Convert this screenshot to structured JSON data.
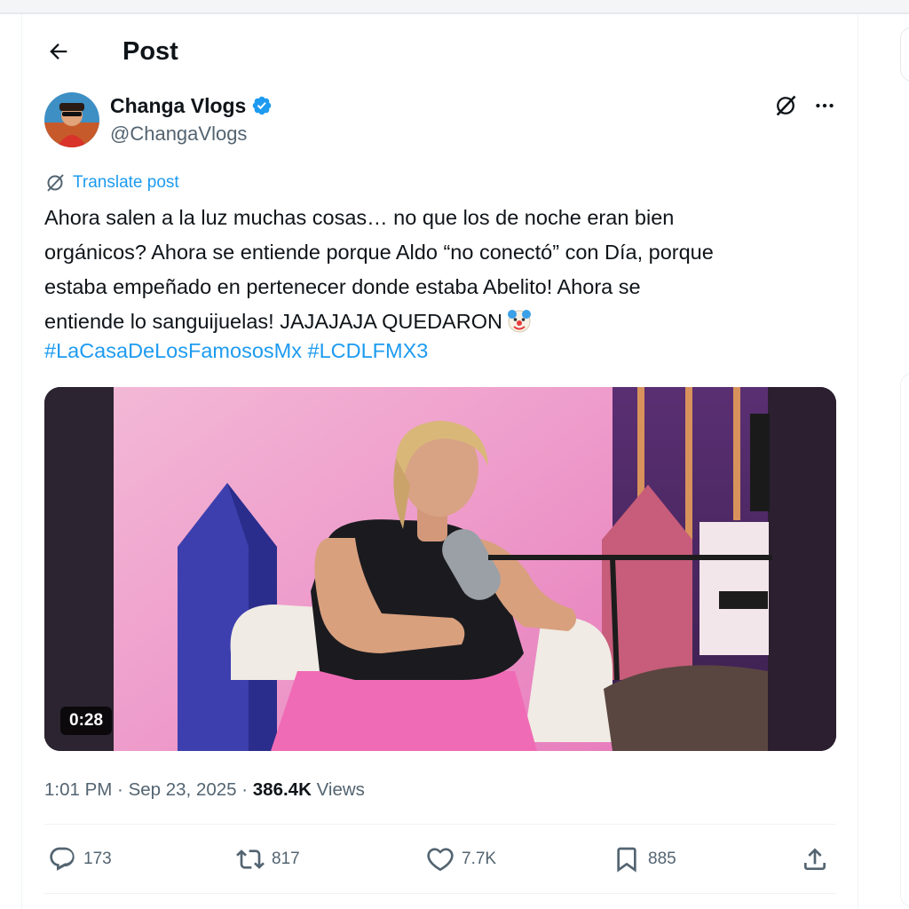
{
  "header": {
    "title": "Post"
  },
  "author": {
    "name": "Changa Vlogs",
    "handle": "@ChangaVlogs",
    "verified": true
  },
  "translate_label": "Translate post",
  "post": {
    "lines": [
      "Ahora salen a la luz muchas cosas… no que los de noche eran bien",
      "orgánicos? Ahora se entiende porque Aldo “no conectó” con Día, porque",
      "estaba empeñado en pertenecer donde estaba Abelito! Ahora se",
      "entiende lo sanguijuelas!  JAJAJAJA QUEDARON"
    ],
    "emoji": "clown-face",
    "hashtags": [
      "#LaCasaDeLosFamososMx",
      "#LCDLFMX3"
    ]
  },
  "media": {
    "duration": "0:28",
    "type": "video"
  },
  "meta": {
    "time": "1:01 PM",
    "date": "Sep 23, 2025",
    "views_count": "386.4K",
    "views_label": "Views"
  },
  "actions": {
    "replies": "173",
    "reposts": "817",
    "likes": "7.7K",
    "bookmarks": "885"
  },
  "colors": {
    "accent": "#1d9bf0",
    "text": "#0f1419",
    "muted": "#536471"
  }
}
